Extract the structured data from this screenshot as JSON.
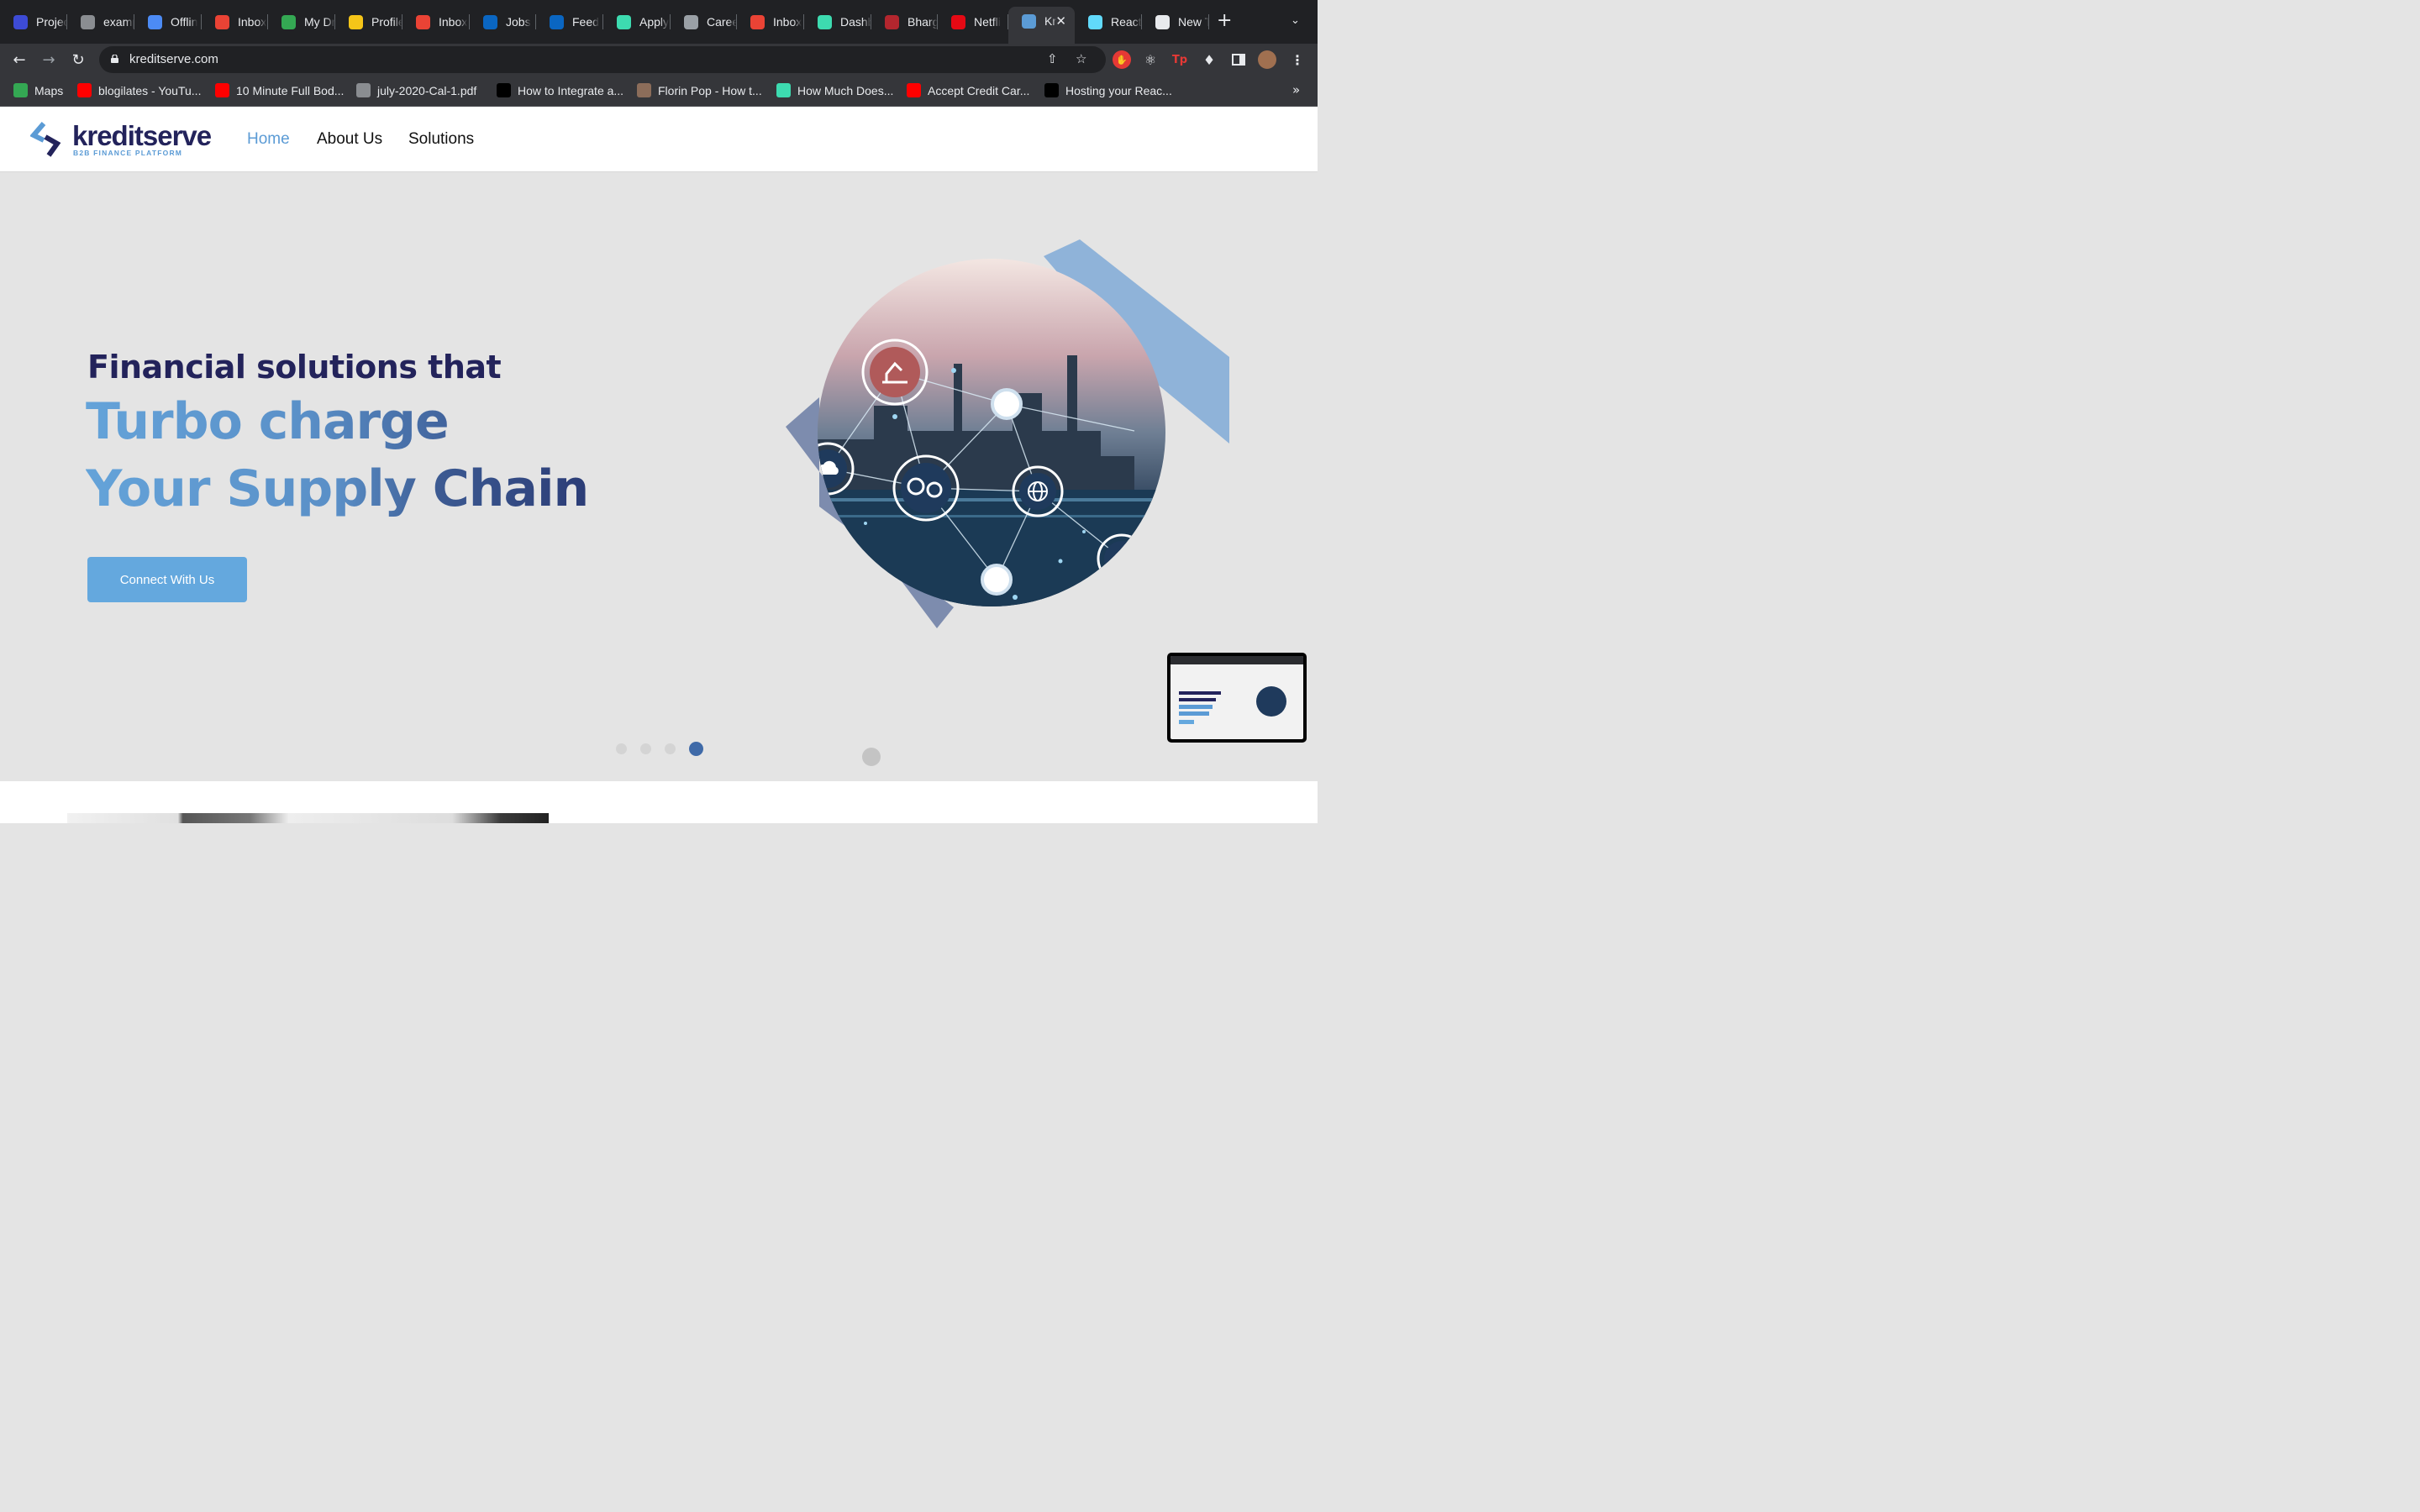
{
  "browser": {
    "tabs": [
      {
        "label": "Projec",
        "icon": "ucsc-icon",
        "color": "#3d4bd6"
      },
      {
        "label": "examp",
        "icon": "globe-icon",
        "color": "#8a8d91"
      },
      {
        "label": "Offlin",
        "icon": "google-docs-icon",
        "color": "#4c8bf5"
      },
      {
        "label": "Inbox",
        "icon": "gmail-icon",
        "color": "#ea4335"
      },
      {
        "label": "My Dr",
        "icon": "google-drive-icon",
        "color": "#34a853"
      },
      {
        "label": "Profile",
        "icon": "smiley-icon",
        "color": "#f5c518"
      },
      {
        "label": "Inbox",
        "icon": "gmail-icon",
        "color": "#ea4335"
      },
      {
        "label": "Jobs",
        "icon": "linkedin-icon",
        "color": "#0a66c2"
      },
      {
        "label": "Feed",
        "icon": "linkedin-icon",
        "color": "#0a66c2"
      },
      {
        "label": "Apply",
        "icon": "bird-icon",
        "color": "#3ddbb0"
      },
      {
        "label": "Caree",
        "icon": "apple-icon",
        "color": "#9aa0a6"
      },
      {
        "label": "Inbox",
        "icon": "gmail-icon",
        "color": "#ea4335"
      },
      {
        "label": "Dashb",
        "icon": "bird-icon",
        "color": "#3ddbb0"
      },
      {
        "label": "Bharg",
        "icon": "feather-icon",
        "color": "#b3262e"
      },
      {
        "label": "Netfli",
        "icon": "netflix-icon",
        "color": "#e50914"
      },
      {
        "label": "Kr",
        "icon": "kreditserve-icon",
        "color": "#5b9bd5",
        "active": true
      },
      {
        "label": "React",
        "icon": "react-icon",
        "color": "#61dafb"
      },
      {
        "label": "New T",
        "icon": "chrome-icon",
        "color": "#e8eaed"
      }
    ],
    "url": "kreditserve.com",
    "bookmarks": [
      {
        "label": "Maps",
        "icon": "maps-icon",
        "color": "#34a853"
      },
      {
        "label": "blogilates - YouTu...",
        "icon": "youtube-icon",
        "color": "#ff0000"
      },
      {
        "label": "10 Minute Full Bod...",
        "icon": "youtube-icon",
        "color": "#ff0000"
      },
      {
        "label": "july-2020-Cal-1.pdf",
        "icon": "globe-icon",
        "color": "#8a8d91"
      },
      {
        "label": "How to Integrate a...",
        "icon": "lightning-icon",
        "color": "#000000"
      },
      {
        "label": "Florin Pop - How t...",
        "icon": "avatar-icon",
        "color": "#8c6d5a"
      },
      {
        "label": "How Much Does...",
        "icon": "leaf-icon",
        "color": "#3ddbb0"
      },
      {
        "label": "Accept Credit Car...",
        "icon": "youtube-icon",
        "color": "#ff0000"
      },
      {
        "label": "Hosting your Reac...",
        "icon": "medium-icon",
        "color": "#000000"
      }
    ]
  },
  "site": {
    "logo_word": "kreditserve",
    "logo_tagline": "B2B FINANCE PLATFORM",
    "nav": [
      "Home",
      "About Us",
      "Solutions"
    ],
    "active_nav": "Home"
  },
  "hero": {
    "line1": "Financial solutions that",
    "line2": "Turbo charge",
    "line3": "Your Supply Chain",
    "cta": "Connect With Us",
    "slides_total": 4,
    "slide_active": 4
  },
  "colors": {
    "navy": "#23235b",
    "accent_blue": "#5b9bd5",
    "button": "#64a8de",
    "hero_bg": "#e4e4e4"
  }
}
